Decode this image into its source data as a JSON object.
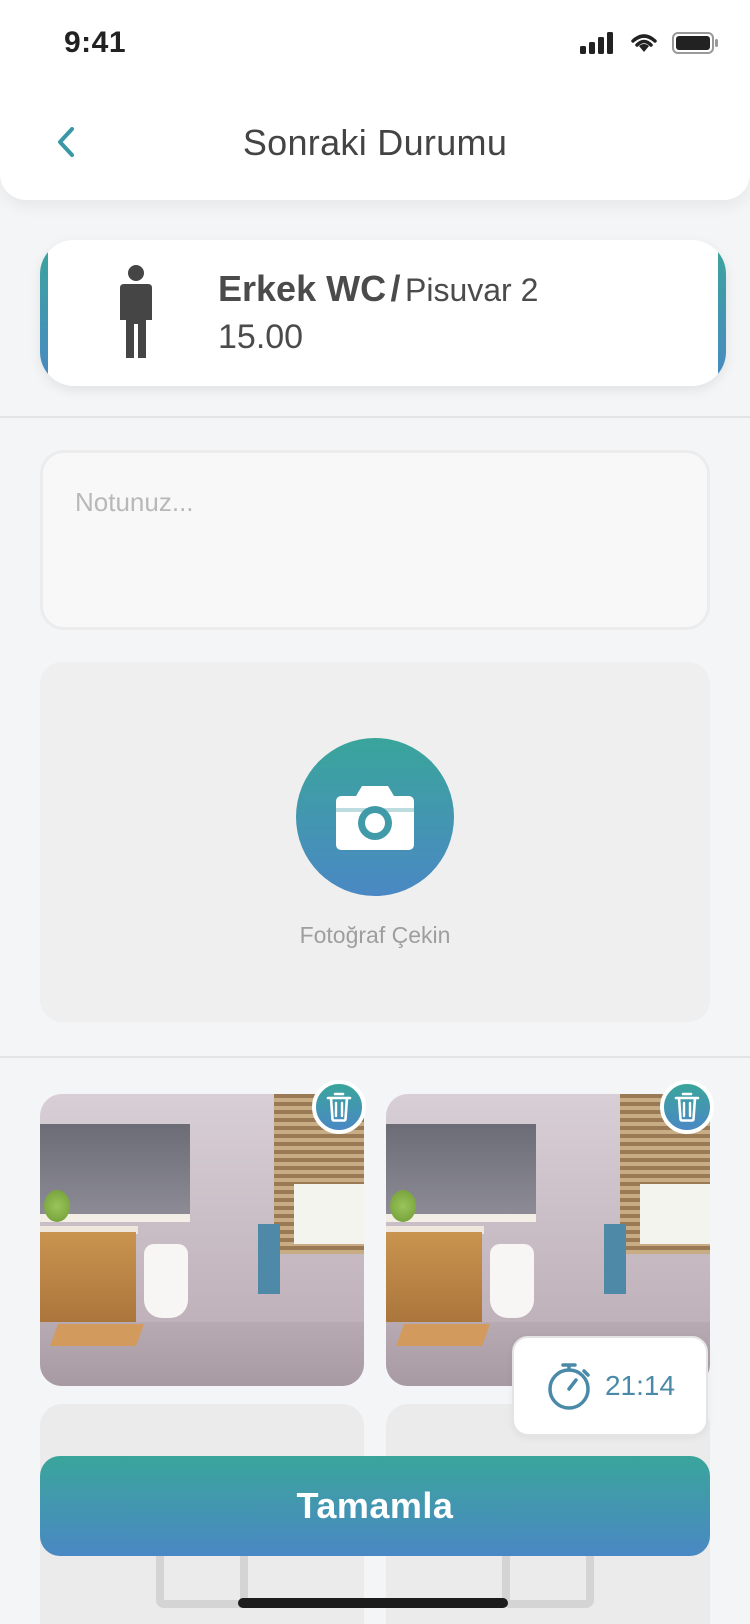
{
  "status_bar": {
    "time": "9:41"
  },
  "header": {
    "title": "Sonraki Durumu"
  },
  "location": {
    "area": "Erkek WC",
    "separator": "/",
    "unit": "Pisuvar 2",
    "time": "15.00"
  },
  "note": {
    "placeholder": "Notunuz..."
  },
  "photo": {
    "capture_label": "Fotoğraf Çekin"
  },
  "timer": {
    "value": "21:14"
  },
  "actions": {
    "complete_label": "Tamamla"
  },
  "colors": {
    "accent_start": "#3aa59b",
    "accent_end": "#4a88c4"
  },
  "icons": [
    "chevron-left-icon",
    "person-icon",
    "camera-icon",
    "trash-icon",
    "stopwatch-icon",
    "image-placeholder-icon",
    "signal-icon",
    "wifi-icon",
    "battery-icon"
  ]
}
